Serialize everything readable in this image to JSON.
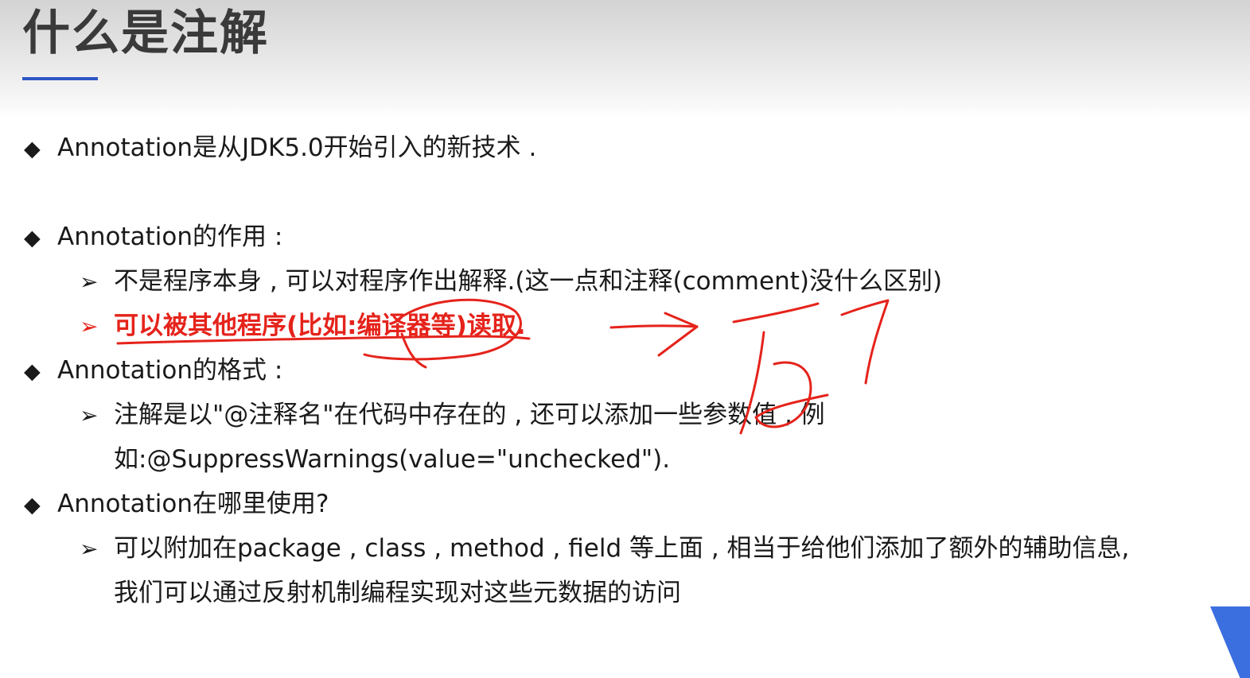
{
  "slide": {
    "title": "什么是注解",
    "accent_color": "#2f56c4",
    "highlight_color": "#e5231b",
    "bullets": [
      {
        "marker": "◆",
        "text": "Annotation是从JDK5.0开始引入的新技术 ."
      },
      {
        "marker": "◆",
        "text": "Annotation的作用 :"
      },
      {
        "marker": "➢",
        "text": "不是程序本身 , 可以对程序作出解释.(这一点和注释(comment)没什么区别)"
      },
      {
        "marker": "➢",
        "text": "可以被其他程序(比如:编译器等)读取."
      },
      {
        "marker": "◆",
        "text": "Annotation的格式 :"
      },
      {
        "marker": "➢",
        "text": "注解是以\"@注释名\"在代码中存在的 , 还可以添加一些参数值 , 例"
      },
      {
        "text": "如:@SuppressWarnings(value=\"unchecked\")."
      },
      {
        "marker": "◆",
        "text": "Annotation在哪里使用?"
      },
      {
        "marker": "➢",
        "text": "可以附加在package , class , method , field 等上面 , 相当于给他们添加了额外的辅助信息,"
      },
      {
        "text": "我们可以通过反射机制编程实现对这些元数据的访问"
      }
    ]
  }
}
